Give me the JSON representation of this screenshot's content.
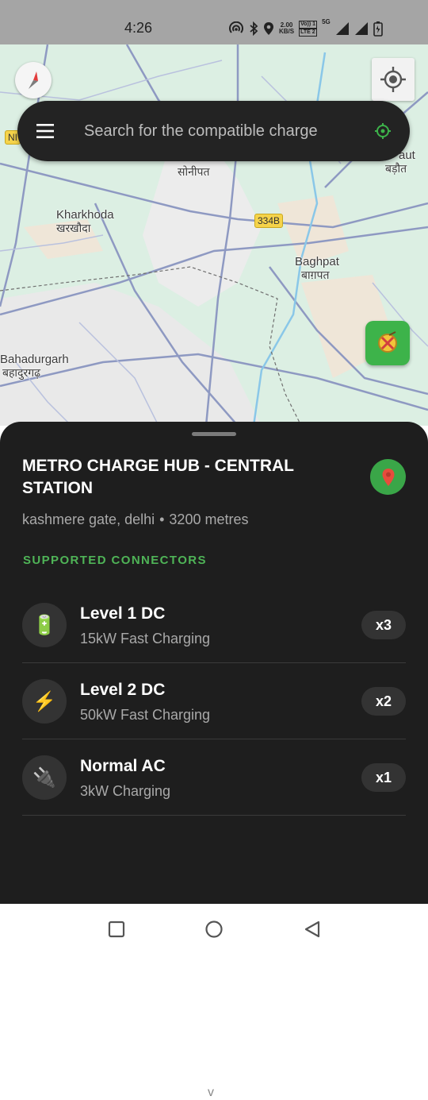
{
  "status_bar": {
    "time": "4:26",
    "speed_value": "2.00",
    "speed_unit": "KB/S",
    "lte_top": "Vo)) 1",
    "lte_bottom": "LTE 2",
    "network": "5G"
  },
  "map": {
    "places": [
      {
        "en": "Kharkhoda",
        "hi": "खरखौदा"
      },
      {
        "en": "Baghpat",
        "hi": "बाग़पत"
      },
      {
        "en": "Bahadurgarh",
        "hi": "बहादुरगढ़"
      },
      {
        "en": "sonipat_hi",
        "hi": "सोनीपत"
      },
      {
        "en": "aut",
        "hi": "बड़ौत"
      }
    ],
    "road_badge": "334B",
    "nh_badge": "NI"
  },
  "search": {
    "placeholder": "Search for the compatible charge"
  },
  "station": {
    "name": "METRO CHARGE HUB - CENTRAL STATION",
    "area": "kashmere gate, delhi",
    "separator": "•",
    "distance": "3200 metres",
    "section_title": "SUPPORTED CONNECTORS",
    "connectors": [
      {
        "icon": "🔋",
        "name": "Level 1 DC",
        "desc": "15kW Fast Charging",
        "count": "x3"
      },
      {
        "icon": "⚡",
        "name": "Level 2 DC",
        "desc": "50kW Fast Charging",
        "count": "x2"
      },
      {
        "icon": "🔌",
        "name": "Normal AC",
        "desc": "3kW Charging",
        "count": "x1"
      }
    ],
    "expand_glyph": "v"
  },
  "colors": {
    "accent_green": "#3db34a",
    "sheet_bg": "#1e1e1e",
    "search_bg": "#232323"
  }
}
